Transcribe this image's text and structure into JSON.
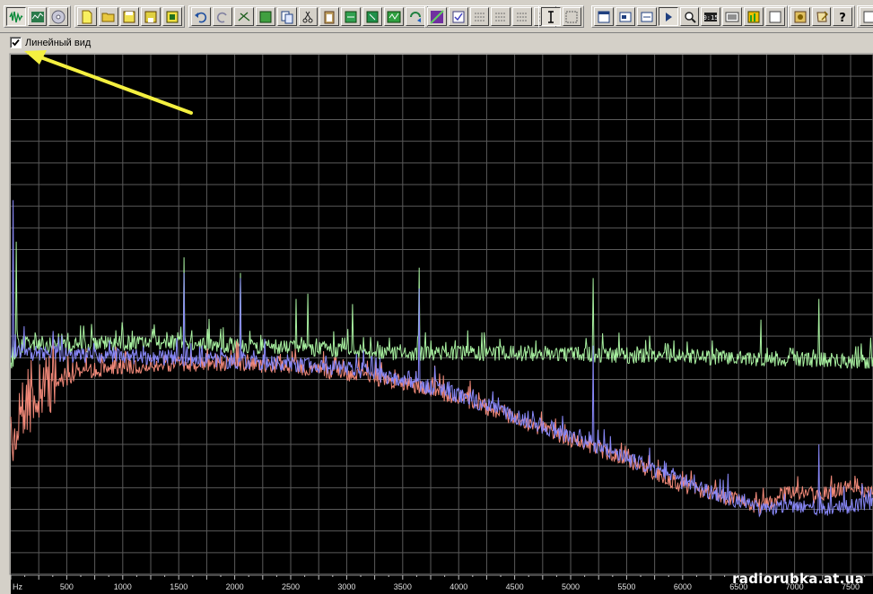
{
  "option_bar": {
    "linear_view_label": "Линейный вид",
    "linear_view_checked": true
  },
  "toolbar": {
    "groups": [
      [
        "waveform-view-icon",
        "spectral-view-icon",
        "cd-icon"
      ],
      [
        "new-file-icon",
        "open-folder-icon",
        "save-icon",
        "save-as-icon",
        "film-icon"
      ],
      [
        "undo-icon",
        "redo-icon",
        "cut-scissors-icon",
        "select-icon",
        "copy-icon",
        "cut-icon",
        "paste-icon",
        "mix-paste-icon",
        "trim-icon",
        "zoom-fit-icon",
        "loop-icon"
      ],
      [
        "draw-envelope-icon",
        "check-edit-icon",
        "grid1-icon",
        "grid2-icon",
        "grid3-icon",
        "grid4-icon"
      ],
      [
        "cursor-ibeam-icon",
        "marquee-icon"
      ],
      [
        "window-icon",
        "transport-icon",
        "status-icon",
        "play-icon",
        "zoom-icon",
        "time-display-icon",
        "level-meter-icon",
        "equalizer-icon",
        "panel-icon"
      ],
      [
        "settings-icon",
        "script-icon",
        "help-icon"
      ],
      [
        "extra-icon"
      ]
    ],
    "pressed": [
      "waveform-view-icon",
      "cursor-ibeam-icon",
      "play-icon"
    ]
  },
  "chart_data": {
    "type": "line",
    "xlabel": "Hz",
    "x_ticks": [
      500,
      1000,
      1500,
      2000,
      2500,
      3000,
      3500,
      4000,
      4500,
      5000,
      5500,
      6000,
      6500,
      7000,
      7500
    ],
    "xlim": [
      0,
      7700
    ],
    "grid": true,
    "series": [
      {
        "color": "#a8f0a0",
        "x": [
          0,
          100,
          200,
          400,
          600,
          800,
          1000,
          1500,
          2000,
          2500,
          3000,
          3500,
          4000,
          4500,
          5000,
          5500,
          6000,
          6500,
          7000,
          7500,
          7700
        ],
        "y": [
          0.58,
          0.56,
          0.555,
          0.56,
          0.56,
          0.555,
          0.555,
          0.555,
          0.56,
          0.565,
          0.57,
          0.575,
          0.575,
          0.575,
          0.575,
          0.58,
          0.58,
          0.585,
          0.585,
          0.59,
          0.59
        ],
        "peaks": [
          [
            50,
            0.36
          ],
          [
            1550,
            0.39
          ],
          [
            2050,
            0.42
          ],
          [
            2550,
            0.47
          ],
          [
            2650,
            0.46
          ],
          [
            3050,
            0.48
          ],
          [
            3650,
            0.41
          ],
          [
            5200,
            0.43
          ],
          [
            6700,
            0.51
          ],
          [
            7220,
            0.47
          ]
        ]
      },
      {
        "color": "#f08878",
        "x": [
          0,
          100,
          200,
          400,
          600,
          800,
          1000,
          1500,
          2000,
          2500,
          3000,
          3500,
          4000,
          4500,
          5000,
          5500,
          6000,
          6500,
          6700,
          7000,
          7200,
          7500,
          7700
        ],
        "y": [
          0.75,
          0.68,
          0.65,
          0.63,
          0.615,
          0.605,
          0.6,
          0.595,
          0.595,
          0.6,
          0.615,
          0.63,
          0.66,
          0.7,
          0.74,
          0.78,
          0.83,
          0.86,
          0.87,
          0.84,
          0.85,
          0.83,
          0.84
        ],
        "peaks": []
      },
      {
        "color": "#8888f8",
        "x": [
          0,
          100,
          200,
          400,
          600,
          800,
          1000,
          1500,
          2000,
          2500,
          3000,
          3500,
          4000,
          4500,
          5000,
          5500,
          6000,
          6500,
          6700,
          7000,
          7200,
          7500,
          7700
        ],
        "y": [
          0.57,
          0.57,
          0.575,
          0.575,
          0.58,
          0.58,
          0.58,
          0.585,
          0.59,
          0.595,
          0.605,
          0.625,
          0.655,
          0.695,
          0.735,
          0.775,
          0.825,
          0.86,
          0.875,
          0.87,
          0.875,
          0.87,
          0.86
        ],
        "peaks": [
          [
            20,
            0.28
          ],
          [
            1550,
            0.42
          ],
          [
            2050,
            0.43
          ],
          [
            3650,
            0.45
          ],
          [
            5200,
            0.56
          ],
          [
            7220,
            0.75
          ]
        ]
      }
    ]
  },
  "watermark": "radiorubka.at.ua"
}
